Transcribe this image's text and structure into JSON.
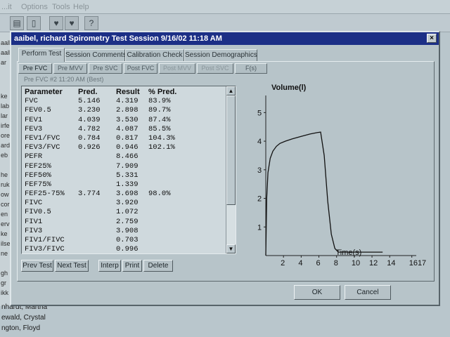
{
  "background_app": {
    "menu": [
      "...it",
      "Options",
      "Tools",
      "Help"
    ],
    "list_fragments": [
      "aalb",
      "aalb",
      "ar",
      "ke",
      "lab",
      "lar",
      "irfe",
      "ore",
      "ard",
      "eb",
      "he",
      "ruk",
      "ow",
      "cor",
      "en",
      "erv",
      "ke",
      "ilse",
      "ne",
      "gh",
      "gr",
      "ikk"
    ],
    "names": [
      "nhardt, Martha",
      "ewald, Crystal",
      "ngton, Floyd"
    ]
  },
  "dialog": {
    "title": "aaibel, richard Spirometry Test Session 9/16/02 11:18 AM",
    "close_label": "×",
    "tabs": [
      {
        "label": "Perform Test"
      },
      {
        "label": "Session Comments"
      },
      {
        "label": "Calibration Check"
      },
      {
        "label": "Session Demographics"
      }
    ],
    "subtabs": [
      {
        "label": "Pre FVC"
      },
      {
        "label": "Pre MVV"
      },
      {
        "label": "Pre SVC"
      },
      {
        "label": "Post FVC"
      },
      {
        "label": "Post MVV"
      },
      {
        "label": "Post SVC"
      },
      {
        "label": "F(s)"
      }
    ],
    "result_label": "Pre FVC #2 11:20 AM (Best)",
    "table": {
      "headers": [
        "Parameter",
        "Pred.",
        "Result",
        "% Pred."
      ],
      "rows": [
        [
          "FVC",
          "5.146",
          "4.319",
          "83.9%"
        ],
        [
          "FEV0.5",
          "3.230",
          "2.898",
          "89.7%"
        ],
        [
          "FEV1",
          "4.039",
          "3.530",
          "87.4%"
        ],
        [
          "FEV3",
          "4.782",
          "4.087",
          "85.5%"
        ],
        [
          "FEV1/FVC",
          "0.784",
          "0.817",
          "104.3%"
        ],
        [
          "FEV3/FVC",
          "0.926",
          "0.946",
          "102.1%"
        ],
        [
          "PEFR",
          "",
          "8.466",
          ""
        ],
        [
          "FEF25%",
          "",
          "7.909",
          ""
        ],
        [
          "FEF50%",
          "",
          "5.331",
          ""
        ],
        [
          "FEF75%",
          "",
          "1.339",
          ""
        ],
        [
          "FEF25-75%",
          "3.774",
          "3.698",
          "98.0%"
        ],
        [
          "FIVC",
          "",
          "3.920",
          ""
        ],
        [
          "FIV0.5",
          "",
          "1.072",
          ""
        ],
        [
          "FIV1",
          "",
          "2.759",
          ""
        ],
        [
          "FIV3",
          "",
          "3.908",
          ""
        ],
        [
          "FIV1/FIVC",
          "",
          "0.703",
          ""
        ],
        [
          "FIV3/FIVC",
          "",
          "0.996",
          ""
        ]
      ]
    },
    "buttons": {
      "prev_test": "Prev Test",
      "next_test": "Next Test",
      "interp": "Interp",
      "print": "Print",
      "delete": "Delete",
      "ok": "OK",
      "cancel": "Cancel"
    }
  },
  "chart_data": {
    "type": "line",
    "title": "",
    "ylabel": "Volume(l)",
    "xlabel": "Time(s)",
    "xlim": [
      0,
      17
    ],
    "ylim": [
      0,
      5.5
    ],
    "x_ticks": [
      "2",
      "4",
      "6",
      "8",
      "10",
      "12",
      "14",
      "1617"
    ],
    "x_tick_values": [
      2,
      4,
      6,
      8,
      10,
      12,
      14,
      16.5
    ],
    "y_ticks": [
      1,
      2,
      3,
      4,
      5
    ],
    "series": [
      {
        "x": [
          0,
          0.1,
          0.25,
          0.5,
          0.8,
          1.2,
          1.6,
          2.2,
          3,
          4,
          5,
          5.8,
          6.2,
          6.6,
          7,
          7.4,
          7.8,
          8.2,
          9,
          10,
          11,
          12,
          13.2
        ],
        "y": [
          0,
          2.0,
          2.9,
          3.4,
          3.65,
          3.82,
          3.92,
          4.0,
          4.08,
          4.17,
          4.25,
          4.3,
          4.32,
          3.5,
          1.9,
          0.75,
          0.25,
          0.12,
          0.12,
          0.12,
          0.12,
          0.12,
          0.12
        ]
      }
    ]
  }
}
